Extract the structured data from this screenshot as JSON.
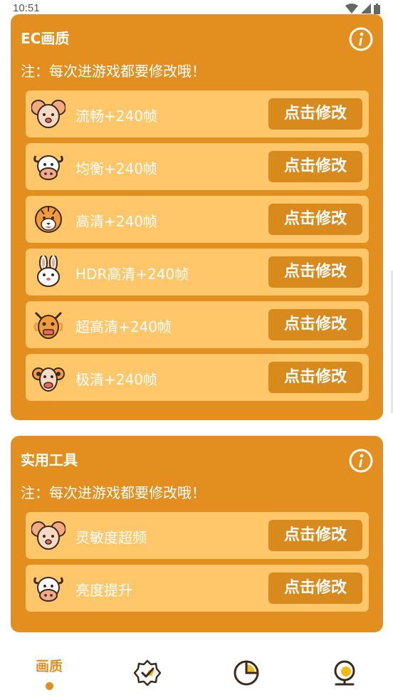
{
  "status": {
    "time": "10:51"
  },
  "panel1": {
    "title": "EC画质",
    "note": "注：每次进游戏都要修改哦！",
    "rows": [
      {
        "icon": "rat-icon",
        "label": "流畅+240帧",
        "button": "点击修改"
      },
      {
        "icon": "ox-icon",
        "label": "均衡+240帧",
        "button": "点击修改"
      },
      {
        "icon": "tiger-icon",
        "label": "高清+240帧",
        "button": "点击修改"
      },
      {
        "icon": "rabbit-icon",
        "label": "HDR高清+240帧",
        "button": "点击修改"
      },
      {
        "icon": "dragon-icon",
        "label": "超高清+240帧",
        "button": "点击修改"
      },
      {
        "icon": "ram-icon",
        "label": "极清+240帧",
        "button": "点击修改"
      }
    ]
  },
  "panel2": {
    "title": "实用工具",
    "note": "注：每次进游戏都要修改哦！",
    "rows": [
      {
        "icon": "rat-icon",
        "label": "灵敏度超频",
        "button": "点击修改"
      },
      {
        "icon": "ox-icon",
        "label": "亮度提升",
        "button": "点击修改"
      }
    ]
  },
  "nav": {
    "active_label": "画质",
    "items": [
      "quality",
      "verified-badge-icon",
      "pie-chart-icon",
      "webcam-icon"
    ]
  },
  "colors": {
    "panel": "#E38F1F",
    "row": "#FFC76A",
    "button": "#D98A1D",
    "text": "#FFFFFF"
  }
}
